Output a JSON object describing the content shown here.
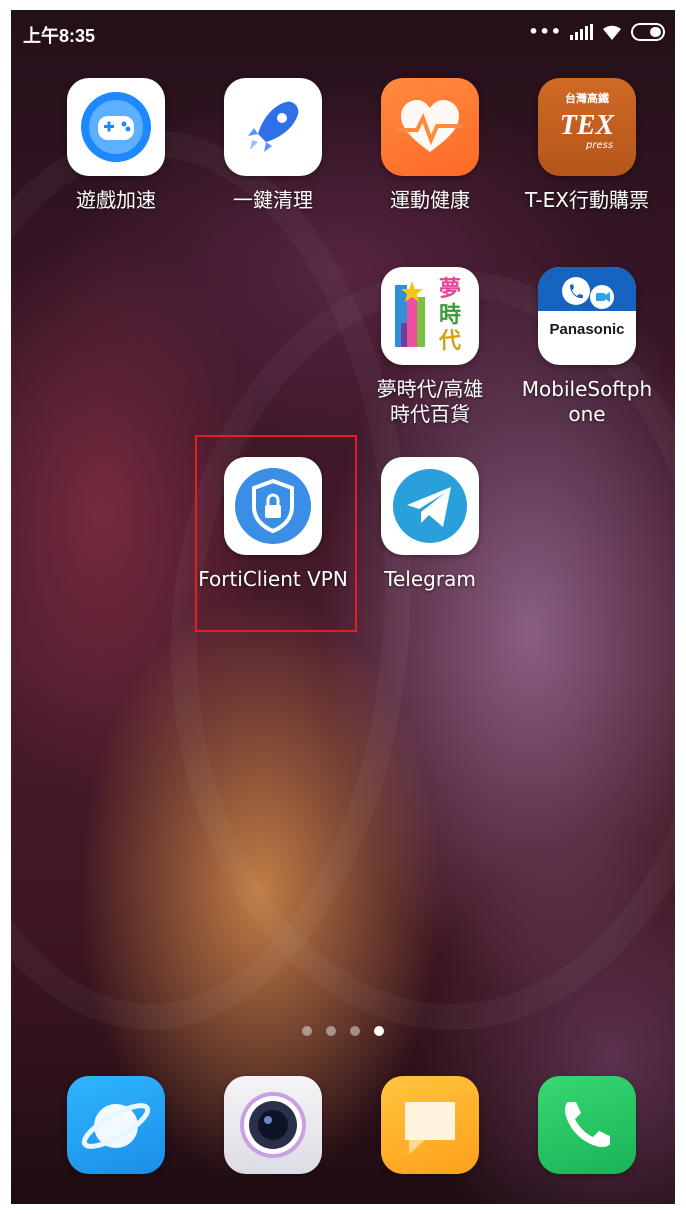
{
  "status_bar": {
    "time": "上午8:35",
    "icons": [
      "more-dots-icon",
      "signal-icon",
      "wifi-icon",
      "battery-icon"
    ]
  },
  "apps": [
    {
      "name": "game-turbo",
      "label": "遊戲加速",
      "icon": "gamepad-icon",
      "color": "#1e88ff"
    },
    {
      "name": "cleaner",
      "label": "一鍵清理",
      "icon": "rocket-icon",
      "color": "#2f6fe8"
    },
    {
      "name": "health",
      "label": "運動健康",
      "icon": "heart-icon",
      "color": "#ff7a33"
    },
    {
      "name": "t-ex",
      "label": "T-EX行動購票",
      "icon": "t-ex-logo-icon",
      "color": "#c9621e",
      "logo_text_top": "台灣高鐵",
      "logo_text_main": "TEX",
      "logo_text_sub": "press"
    },
    {
      "name": "dream-mall",
      "label": "夢時代/高雄\n時代百貨",
      "icon": "dream-mall-logo-icon",
      "logo_chars": [
        "夢",
        "時",
        "代"
      ]
    },
    {
      "name": "mobile-softphone",
      "label": "MobileSoftph\none",
      "icon": "panasonic-softphone-icon",
      "color": "#1565c0",
      "logo_text": "Panasonic"
    },
    {
      "name": "forticlient-vpn",
      "label": "FortiClient VPN",
      "icon": "shield-lock-icon",
      "color": "#3a8ee6"
    },
    {
      "name": "telegram",
      "label": "Telegram",
      "icon": "paper-plane-icon",
      "color": "#2aa0da"
    }
  ],
  "page_indicator": {
    "count": 4,
    "active": 4
  },
  "dock": [
    {
      "name": "browser",
      "icon": "planet-icon",
      "color": "#27a4f2"
    },
    {
      "name": "camera",
      "icon": "camera-lens-icon",
      "color": "#e9e9ef"
    },
    {
      "name": "messages",
      "icon": "message-bubble-icon",
      "color": "#ffb52e"
    },
    {
      "name": "phone",
      "icon": "phone-handset-icon",
      "color": "#22c55e"
    }
  ],
  "highlight_color": "#e02020"
}
